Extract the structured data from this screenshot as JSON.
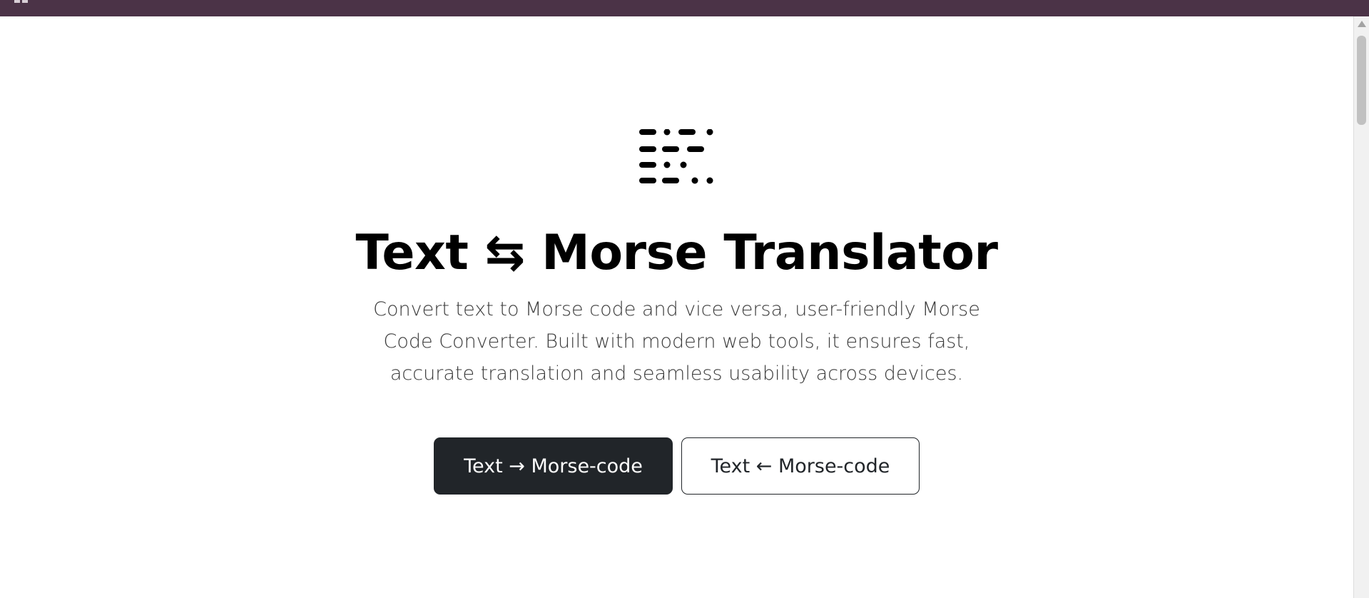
{
  "window": {
    "titlebar_color": "#4b3347"
  },
  "hero": {
    "logo_icon": "morse-code-icon",
    "title": "Text ⇆ Morse Translator",
    "description": "Convert text to Morse code and vice versa, user-friendly Morse Code Converter. Built with modern web tools, it ensures fast, accurate translation and seamless usability across devices."
  },
  "actions": {
    "to_morse_label": "Text → Morse-code",
    "from_morse_label": "Text ← Morse-code"
  },
  "colors": {
    "primary_button_bg": "#212529",
    "primary_button_text": "#ffffff",
    "outline_button_border": "#212529",
    "title_text": "#000000",
    "description_text": "#3a3a3a"
  }
}
